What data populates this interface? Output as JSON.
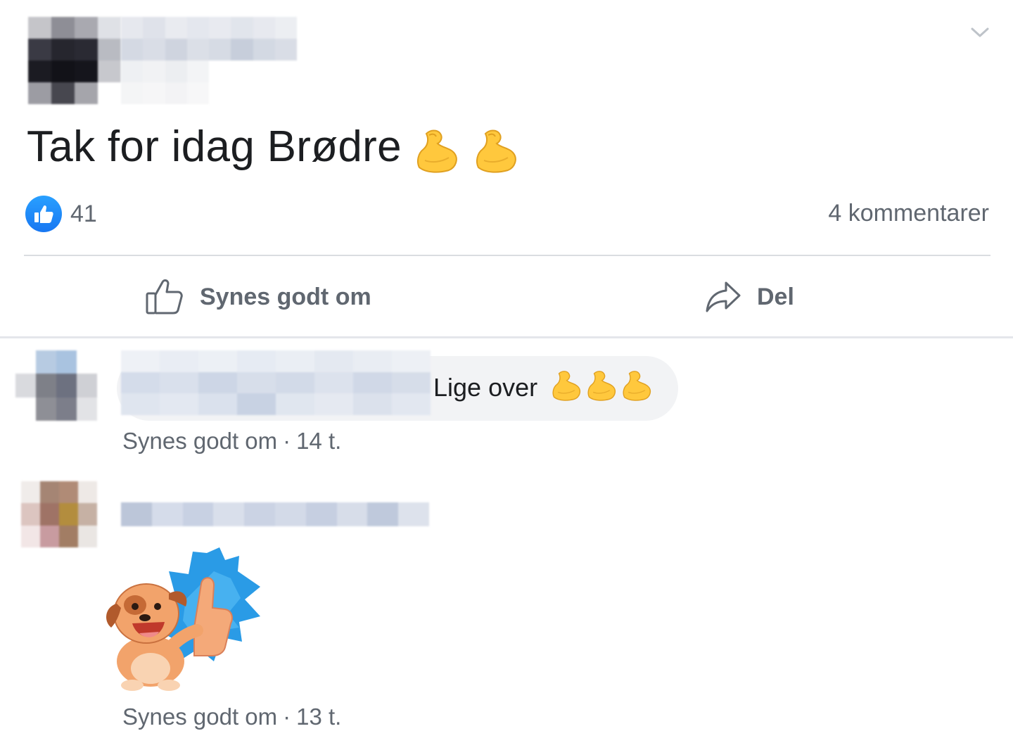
{
  "post": {
    "text": "Tak for idag Brødre",
    "text_emojis": [
      "flexed-biceps",
      "flexed-biceps"
    ],
    "reaction_icon": "like-icon",
    "like_count": "41",
    "comment_count": "4 kommentarer",
    "menu_icon": "chevron-down-icon"
  },
  "actions": {
    "like_label": "Synes godt om",
    "share_label": "Del"
  },
  "comments": [
    {
      "text": "Lige over",
      "emojis": [
        "flexed-biceps",
        "flexed-biceps",
        "flexed-biceps"
      ],
      "like_label": "Synes godt om",
      "separator": "·",
      "time": "14 t."
    },
    {
      "sticker": "thumbs-up-puppy-sticker",
      "like_label": "Synes godt om",
      "separator": "·",
      "time": "13 t."
    }
  ],
  "colors": {
    "accent": "#1877f2",
    "secondary_text": "#606770",
    "bubble": "#f2f3f5",
    "divider": "#dadde1",
    "emoji_yellow": "#ffc83d"
  }
}
